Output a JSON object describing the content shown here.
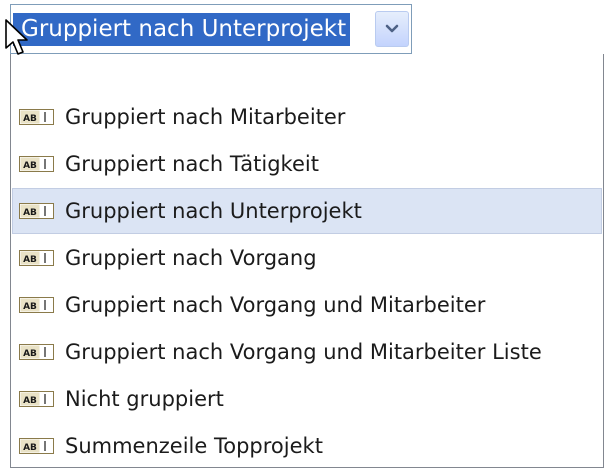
{
  "combo": {
    "selected_value": "Gruppiert nach Unterprojekt",
    "button_icon": "chevron-down-icon"
  },
  "dropdown": {
    "item_icon": "text-field-icon",
    "items": [
      {
        "label": "Gruppiert nach Mitarbeiter",
        "selected": false
      },
      {
        "label": "Gruppiert nach Tätigkeit",
        "selected": false
      },
      {
        "label": "Gruppiert nach Unterprojekt",
        "selected": true
      },
      {
        "label": "Gruppiert nach Vorgang",
        "selected": false
      },
      {
        "label": "Gruppiert nach Vorgang und Mitarbeiter",
        "selected": false
      },
      {
        "label": "Gruppiert nach Vorgang und Mitarbeiter Liste",
        "selected": false
      },
      {
        "label": "Nicht gruppiert",
        "selected": false
      },
      {
        "label": "Summenzeile Topprojekt",
        "selected": false
      }
    ]
  },
  "colors": {
    "selection_highlight": "#3169c6",
    "hover_highlight": "#dbe4f4",
    "combo_border": "#7f9db9"
  }
}
